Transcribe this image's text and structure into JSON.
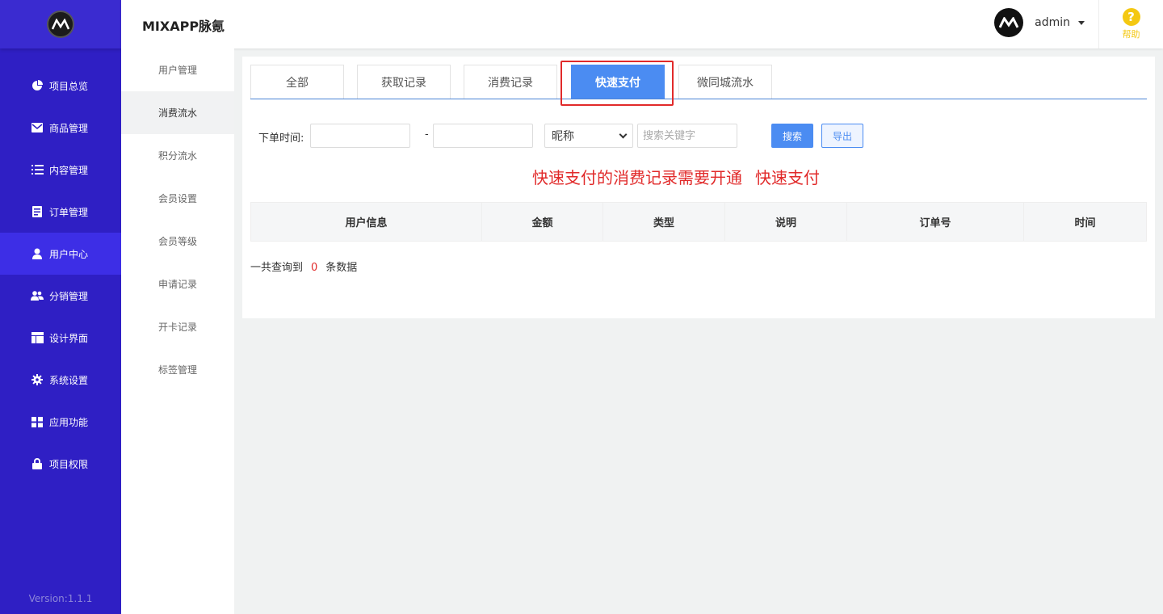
{
  "app": {
    "title": "MIXAPP脉氪"
  },
  "sidebar": {
    "items": [
      {
        "label": "项目总览",
        "icon": "pie-chart-icon"
      },
      {
        "label": "商品管理",
        "icon": "envelope-icon"
      },
      {
        "label": "内容管理",
        "icon": "list-icon"
      },
      {
        "label": "订单管理",
        "icon": "document-icon"
      },
      {
        "label": "用户中心",
        "icon": "user-icon",
        "active": true
      },
      {
        "label": "分销管理",
        "icon": "users-icon"
      },
      {
        "label": "设计界面",
        "icon": "layout-icon"
      },
      {
        "label": "系统设置",
        "icon": "gear-icon"
      },
      {
        "label": "应用功能",
        "icon": "grid-icon"
      },
      {
        "label": "项目权限",
        "icon": "lock-icon"
      }
    ],
    "version": "Version:1.1.1"
  },
  "submenu": {
    "items": [
      {
        "label": "用户管理"
      },
      {
        "label": "消费流水",
        "active": true
      },
      {
        "label": "积分流水"
      },
      {
        "label": "会员设置"
      },
      {
        "label": "会员等级"
      },
      {
        "label": "申请记录"
      },
      {
        "label": "开卡记录"
      },
      {
        "label": "标签管理"
      }
    ]
  },
  "header": {
    "username": "admin",
    "help_label": "帮助",
    "help_icon": "?"
  },
  "tabs": [
    {
      "label": "全部"
    },
    {
      "label": "获取记录"
    },
    {
      "label": "消费记录"
    },
    {
      "label": "快速支付",
      "active": true
    },
    {
      "label": "微同城流水"
    }
  ],
  "filter": {
    "label": "下单时间:",
    "date_start_value": "",
    "date_end_value": "",
    "dash": "-",
    "select_value": "昵称",
    "keyword_placeholder": "搜索关键字",
    "search_label": "搜索",
    "export_label": "导出"
  },
  "notice": {
    "text": "快速支付的消费记录需要开通",
    "link": "快速支付"
  },
  "table": {
    "headers": [
      "用户信息",
      "金额",
      "类型",
      "说明",
      "订单号",
      "时间"
    ]
  },
  "result": {
    "prefix": "一共查询到",
    "count": "0",
    "suffix": "条数据"
  },
  "colors": {
    "sidebar_bg": "#2f1fc4",
    "accent": "#4b8cf2",
    "highlight": "#e12a2a",
    "help": "#f4c812"
  }
}
